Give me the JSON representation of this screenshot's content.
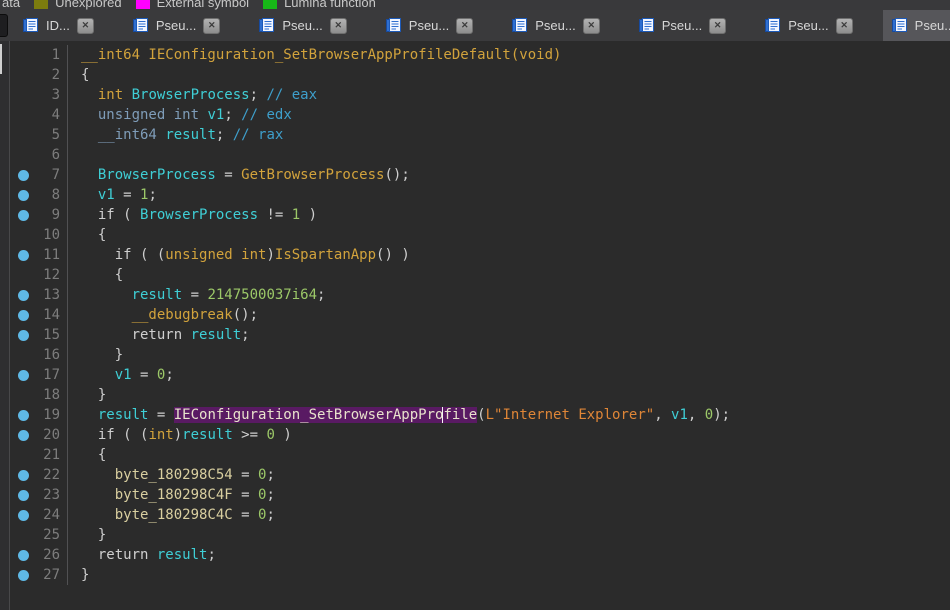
{
  "legend": {
    "partial_label": "ata",
    "items": [
      {
        "label": "Unexplored",
        "color": "#7c7c0e"
      },
      {
        "label": "External symbol",
        "color": "#ff00ff"
      },
      {
        "label": "Lumina function",
        "color": "#17b817"
      }
    ]
  },
  "tabs": {
    "close_glyph": "✕",
    "items": [
      {
        "label": "ID...",
        "active": false
      },
      {
        "label": "Pseu...",
        "active": false
      },
      {
        "label": "Pseu...",
        "active": false
      },
      {
        "label": "Pseu...",
        "active": false
      },
      {
        "label": "Pseu...",
        "active": false
      },
      {
        "label": "Pseu...",
        "active": false
      },
      {
        "label": "Pseu...",
        "active": false
      },
      {
        "label": "Pseu...",
        "active": true
      }
    ]
  },
  "colors": {
    "background": "#2b2b2b",
    "function_yellow": "#d2a33c",
    "local_variable_cyan": "#3fcfd6",
    "number_green": "#9cc868",
    "type_steel_blue": "#7f9db9",
    "comment_blue": "#3e9fcb",
    "global_khaki": "#d9cfa0",
    "string_orange": "#df8637",
    "highlight_purple": "#591a63",
    "breakpoint_blue": "#5fb9e6"
  },
  "code": {
    "lines": [
      {
        "n": 1,
        "bp": false,
        "seg": [
          [
            "y",
            "__int64 IEConfiguration_SetBrowserAppProfileDefault(void)"
          ]
        ]
      },
      {
        "n": 2,
        "bp": false,
        "seg": [
          [
            "d",
            "{"
          ]
        ]
      },
      {
        "n": 3,
        "bp": false,
        "seg": [
          [
            "d",
            "  "
          ],
          [
            "y",
            "int"
          ],
          [
            "d",
            " "
          ],
          [
            "c",
            "BrowserProcess"
          ],
          [
            "d",
            "; "
          ],
          [
            "m",
            "// eax"
          ]
        ]
      },
      {
        "n": 4,
        "bp": false,
        "seg": [
          [
            "d",
            "  "
          ],
          [
            "k",
            "unsigned int"
          ],
          [
            "d",
            " "
          ],
          [
            "c",
            "v1"
          ],
          [
            "d",
            "; "
          ],
          [
            "m",
            "// edx"
          ]
        ]
      },
      {
        "n": 5,
        "bp": false,
        "seg": [
          [
            "d",
            "  "
          ],
          [
            "k",
            "__int64"
          ],
          [
            "d",
            " "
          ],
          [
            "c",
            "result"
          ],
          [
            "d",
            "; "
          ],
          [
            "m",
            "// rax"
          ]
        ]
      },
      {
        "n": 6,
        "bp": false,
        "seg": []
      },
      {
        "n": 7,
        "bp": true,
        "seg": [
          [
            "d",
            "  "
          ],
          [
            "c",
            "BrowserProcess"
          ],
          [
            "d",
            " = "
          ],
          [
            "y",
            "GetBrowserProcess"
          ],
          [
            "d",
            "();"
          ]
        ]
      },
      {
        "n": 8,
        "bp": true,
        "seg": [
          [
            "d",
            "  "
          ],
          [
            "c",
            "v1"
          ],
          [
            "d",
            " = "
          ],
          [
            "n",
            "1"
          ],
          [
            "d",
            ";"
          ]
        ]
      },
      {
        "n": 9,
        "bp": true,
        "seg": [
          [
            "d",
            "  if ( "
          ],
          [
            "c",
            "BrowserProcess"
          ],
          [
            "d",
            " != "
          ],
          [
            "n",
            "1"
          ],
          [
            "d",
            " )"
          ]
        ]
      },
      {
        "n": 10,
        "bp": false,
        "seg": [
          [
            "d",
            "  {"
          ]
        ]
      },
      {
        "n": 11,
        "bp": true,
        "seg": [
          [
            "d",
            "    if ( ("
          ],
          [
            "y",
            "unsigned int"
          ],
          [
            "d",
            ")"
          ],
          [
            "y",
            "IsSpartanApp"
          ],
          [
            "d",
            "() )"
          ]
        ]
      },
      {
        "n": 12,
        "bp": false,
        "seg": [
          [
            "d",
            "    {"
          ]
        ]
      },
      {
        "n": 13,
        "bp": true,
        "seg": [
          [
            "d",
            "      "
          ],
          [
            "c",
            "result"
          ],
          [
            "d",
            " = "
          ],
          [
            "n",
            "2147500037i64"
          ],
          [
            "d",
            ";"
          ]
        ]
      },
      {
        "n": 14,
        "bp": true,
        "seg": [
          [
            "d",
            "      "
          ],
          [
            "y",
            "__debugbreak"
          ],
          [
            "d",
            "();"
          ]
        ]
      },
      {
        "n": 15,
        "bp": true,
        "seg": [
          [
            "d",
            "      return "
          ],
          [
            "c",
            "result"
          ],
          [
            "d",
            ";"
          ]
        ]
      },
      {
        "n": 16,
        "bp": false,
        "seg": [
          [
            "d",
            "    }"
          ]
        ]
      },
      {
        "n": 17,
        "bp": true,
        "seg": [
          [
            "d",
            "    "
          ],
          [
            "c",
            "v1"
          ],
          [
            "d",
            " = "
          ],
          [
            "n",
            "0"
          ],
          [
            "d",
            ";"
          ]
        ]
      },
      {
        "n": 18,
        "bp": false,
        "seg": [
          [
            "d",
            "  }"
          ]
        ]
      },
      {
        "n": 19,
        "bp": true,
        "seg": [
          [
            "d",
            "  "
          ],
          [
            "c",
            "result"
          ],
          [
            "d",
            " = "
          ],
          [
            "hl",
            "IEConfiguration_SetBrowserAppPro"
          ],
          [
            "caret",
            ""
          ],
          [
            "hl",
            "file"
          ],
          [
            "d",
            "("
          ],
          [
            "s",
            "L\"Internet Explorer\""
          ],
          [
            "d",
            ", "
          ],
          [
            "c",
            "v1"
          ],
          [
            "d",
            ", "
          ],
          [
            "n",
            "0"
          ],
          [
            "d",
            ");"
          ]
        ]
      },
      {
        "n": 20,
        "bp": true,
        "seg": [
          [
            "d",
            "  if ( ("
          ],
          [
            "y",
            "int"
          ],
          [
            "d",
            ")"
          ],
          [
            "c",
            "result"
          ],
          [
            "d",
            " >= "
          ],
          [
            "n",
            "0"
          ],
          [
            "d",
            " )"
          ]
        ]
      },
      {
        "n": 21,
        "bp": false,
        "seg": [
          [
            "d",
            "  {"
          ]
        ]
      },
      {
        "n": 22,
        "bp": true,
        "seg": [
          [
            "d",
            "    "
          ],
          [
            "g",
            "byte_180298C54"
          ],
          [
            "d",
            " = "
          ],
          [
            "n",
            "0"
          ],
          [
            "d",
            ";"
          ]
        ]
      },
      {
        "n": 23,
        "bp": true,
        "seg": [
          [
            "d",
            "    "
          ],
          [
            "g",
            "byte_180298C4F"
          ],
          [
            "d",
            " = "
          ],
          [
            "n",
            "0"
          ],
          [
            "d",
            ";"
          ]
        ]
      },
      {
        "n": 24,
        "bp": true,
        "seg": [
          [
            "d",
            "    "
          ],
          [
            "g",
            "byte_180298C4C"
          ],
          [
            "d",
            " = "
          ],
          [
            "n",
            "0"
          ],
          [
            "d",
            ";"
          ]
        ]
      },
      {
        "n": 25,
        "bp": false,
        "seg": [
          [
            "d",
            "  }"
          ]
        ]
      },
      {
        "n": 26,
        "bp": true,
        "seg": [
          [
            "d",
            "  return "
          ],
          [
            "c",
            "result"
          ],
          [
            "d",
            ";"
          ]
        ]
      },
      {
        "n": 27,
        "bp": true,
        "seg": [
          [
            "d",
            "}"
          ]
        ]
      }
    ]
  }
}
